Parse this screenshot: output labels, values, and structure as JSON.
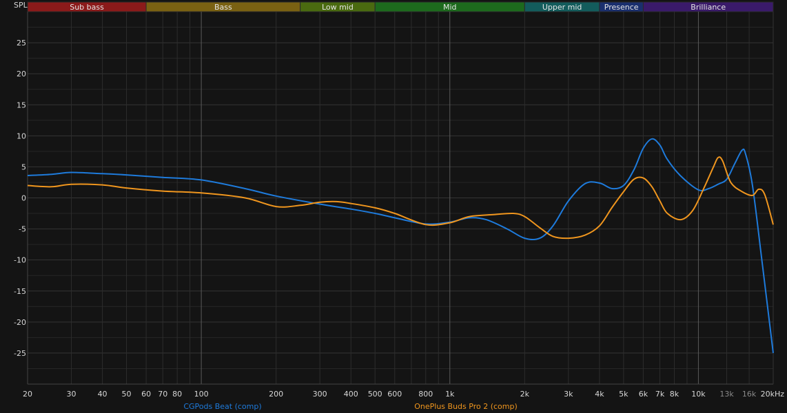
{
  "chart_data": {
    "type": "line",
    "title": "",
    "ylabel": "SPL",
    "xlabel": "",
    "x_scale": "log",
    "xlim": [
      20,
      20000
    ],
    "ylim": [
      -30,
      30
    ],
    "y_ticks": [
      25,
      20,
      15,
      10,
      5,
      0,
      -5,
      -10,
      -15,
      -20,
      -25
    ],
    "x_ticks": [
      {
        "value": 20,
        "label": "20"
      },
      {
        "value": 30,
        "label": "30"
      },
      {
        "value": 40,
        "label": "40"
      },
      {
        "value": 50,
        "label": "50"
      },
      {
        "value": 60,
        "label": "60"
      },
      {
        "value": 70,
        "label": "70"
      },
      {
        "value": 80,
        "label": "80"
      },
      {
        "value": 100,
        "label": "100"
      },
      {
        "value": 200,
        "label": "200"
      },
      {
        "value": 300,
        "label": "300"
      },
      {
        "value": 400,
        "label": "400"
      },
      {
        "value": 500,
        "label": "500"
      },
      {
        "value": 600,
        "label": "600"
      },
      {
        "value": 800,
        "label": "800"
      },
      {
        "value": 1000,
        "label": "1k"
      },
      {
        "value": 2000,
        "label": "2k"
      },
      {
        "value": 3000,
        "label": "3k"
      },
      {
        "value": 4000,
        "label": "4k"
      },
      {
        "value": 5000,
        "label": "5k"
      },
      {
        "value": 6000,
        "label": "6k"
      },
      {
        "value": 7000,
        "label": "7k"
      },
      {
        "value": 8000,
        "label": "8k"
      },
      {
        "value": 10000,
        "label": "10k"
      },
      {
        "value": 13000,
        "label": "13k",
        "dim": true
      },
      {
        "value": 16000,
        "label": "16k",
        "dim": true
      },
      {
        "value": 20000,
        "label": "20kHz"
      }
    ],
    "grid": true,
    "bands": [
      {
        "label": "Sub bass",
        "from": 20,
        "to": 60,
        "color": "#8b1a1a"
      },
      {
        "label": "Bass",
        "from": 60,
        "to": 250,
        "color": "#7a6112"
      },
      {
        "label": "Low mid",
        "from": 250,
        "to": 500,
        "color": "#4a6a10"
      },
      {
        "label": "Mid",
        "from": 500,
        "to": 2000,
        "color": "#1d6a1d"
      },
      {
        "label": "Upper mid",
        "from": 2000,
        "to": 4000,
        "color": "#135c5c"
      },
      {
        "label": "Presence",
        "from": 4000,
        "to": 6000,
        "color": "#1a2f6e"
      },
      {
        "label": "Brilliance",
        "from": 6000,
        "to": 20000,
        "color": "#3a1a6a"
      }
    ],
    "series": [
      {
        "name": "CGPods Beat (comp)",
        "color": "#1e7bdc",
        "points": [
          [
            20,
            3.6
          ],
          [
            25,
            3.8
          ],
          [
            30,
            4.1
          ],
          [
            40,
            3.9
          ],
          [
            50,
            3.7
          ],
          [
            70,
            3.3
          ],
          [
            100,
            2.9
          ],
          [
            150,
            1.5
          ],
          [
            200,
            0.3
          ],
          [
            300,
            -1.0
          ],
          [
            400,
            -1.8
          ],
          [
            500,
            -2.5
          ],
          [
            600,
            -3.2
          ],
          [
            800,
            -4.2
          ],
          [
            1000,
            -3.9
          ],
          [
            1200,
            -3.2
          ],
          [
            1400,
            -3.5
          ],
          [
            1700,
            -5.0
          ],
          [
            2000,
            -6.5
          ],
          [
            2300,
            -6.5
          ],
          [
            2600,
            -4.5
          ],
          [
            3000,
            -0.5
          ],
          [
            3500,
            2.3
          ],
          [
            4000,
            2.4
          ],
          [
            4500,
            1.5
          ],
          [
            5000,
            2.0
          ],
          [
            5500,
            4.5
          ],
          [
            6000,
            8.0
          ],
          [
            6500,
            9.5
          ],
          [
            7000,
            8.5
          ],
          [
            7500,
            6.2
          ],
          [
            8500,
            3.5
          ],
          [
            10000,
            1.3
          ],
          [
            11000,
            1.5
          ],
          [
            12000,
            2.2
          ],
          [
            13000,
            3.0
          ],
          [
            14000,
            5.5
          ],
          [
            15000,
            7.7
          ],
          [
            15500,
            7.0
          ],
          [
            16500,
            2.0
          ],
          [
            18000,
            -10.0
          ],
          [
            20000,
            -25.0
          ]
        ]
      },
      {
        "name": "OnePlus Buds Pro 2 (comp)",
        "color": "#f0961e",
        "points": [
          [
            20,
            2.0
          ],
          [
            25,
            1.8
          ],
          [
            30,
            2.2
          ],
          [
            40,
            2.1
          ],
          [
            50,
            1.6
          ],
          [
            70,
            1.1
          ],
          [
            100,
            0.8
          ],
          [
            150,
            0.0
          ],
          [
            200,
            -1.4
          ],
          [
            250,
            -1.2
          ],
          [
            300,
            -0.7
          ],
          [
            350,
            -0.6
          ],
          [
            400,
            -0.9
          ],
          [
            500,
            -1.6
          ],
          [
            600,
            -2.5
          ],
          [
            800,
            -4.3
          ],
          [
            1000,
            -4.0
          ],
          [
            1200,
            -3.0
          ],
          [
            1500,
            -2.7
          ],
          [
            1800,
            -2.5
          ],
          [
            2000,
            -3.0
          ],
          [
            2300,
            -4.8
          ],
          [
            2600,
            -6.2
          ],
          [
            3000,
            -6.5
          ],
          [
            3500,
            -6.0
          ],
          [
            4000,
            -4.5
          ],
          [
            4500,
            -1.5
          ],
          [
            5000,
            1.0
          ],
          [
            5500,
            3.0
          ],
          [
            6000,
            3.2
          ],
          [
            6500,
            1.8
          ],
          [
            7000,
            -0.5
          ],
          [
            7500,
            -2.5
          ],
          [
            8500,
            -3.5
          ],
          [
            9500,
            -2.0
          ],
          [
            10500,
            1.5
          ],
          [
            11500,
            5.0
          ],
          [
            12000,
            6.5
          ],
          [
            12500,
            6.0
          ],
          [
            13500,
            2.5
          ],
          [
            15000,
            1.0
          ],
          [
            16500,
            0.4
          ],
          [
            17500,
            1.4
          ],
          [
            18500,
            0.5
          ],
          [
            20000,
            -4.3
          ]
        ]
      }
    ]
  }
}
